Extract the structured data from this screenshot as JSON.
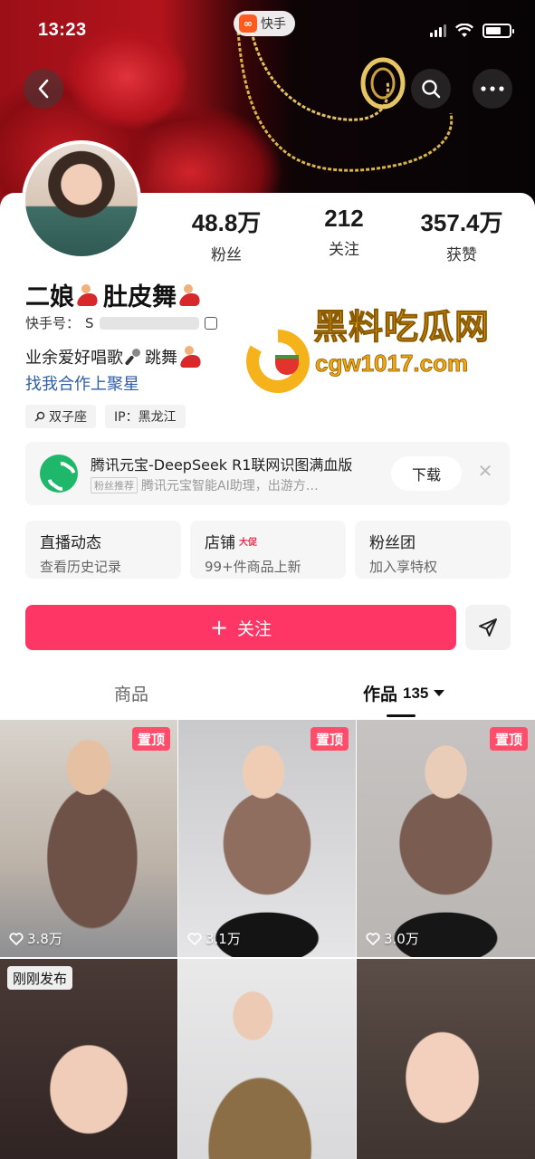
{
  "status_bar": {
    "time": "13:23",
    "app_name": "快手",
    "app_logo": "kuaishou-logo"
  },
  "nav": {
    "back_icon": "chevron-left-icon",
    "search_icon": "search-icon",
    "more_icon": "more-horizontal-icon"
  },
  "profile": {
    "stats": [
      {
        "value": "48.8万",
        "label": "粉丝"
      },
      {
        "value": "212",
        "label": "关注"
      },
      {
        "value": "357.4万",
        "label": "获赞"
      }
    ],
    "nickname_part1": "二娘",
    "nickname_part2": "肚皮舞",
    "kwai_id_label": "快手号：",
    "kwai_id_value": "S",
    "bio_part1": "业余爱好唱歌",
    "bio_part2": "跳舞",
    "cooperation_link": "找我合作上聚星",
    "tags": [
      {
        "icon": "zodiac-icon",
        "text": "双子座"
      },
      {
        "icon": "",
        "text": "IP：黑龙江"
      }
    ]
  },
  "watermark": {
    "title": "黑料吃瓜网",
    "url": "cgw1017.com"
  },
  "ad": {
    "title": "腾讯元宝-DeepSeek R1联网识图满血版",
    "badge": "粉丝推荐",
    "subtitle": "腾讯元宝智能AI助理，出游方…",
    "button": "下载",
    "close": "✕"
  },
  "features": [
    {
      "title": "直播动态",
      "sub": "查看历史记录",
      "badge": ""
    },
    {
      "title": "店铺",
      "sub": "99+件商品上新",
      "badge": "大促"
    },
    {
      "title": "粉丝团",
      "sub": "加入享特权",
      "badge": ""
    }
  ],
  "follow": {
    "plus": "+",
    "label": "关注"
  },
  "tabs": {
    "goods": "商品",
    "works": "作品",
    "works_count": "135"
  },
  "videos": [
    {
      "pinned": "置顶",
      "likes": "3.8万",
      "new_tag": ""
    },
    {
      "pinned": "置顶",
      "likes": "3.1万",
      "new_tag": ""
    },
    {
      "pinned": "置顶",
      "likes": "3.0万",
      "new_tag": ""
    },
    {
      "pinned": "",
      "likes": "",
      "new_tag": "刚刚发布"
    },
    {
      "pinned": "",
      "likes": "",
      "new_tag": ""
    },
    {
      "pinned": "",
      "likes": "",
      "new_tag": ""
    }
  ],
  "colors": {
    "accent": "#fe3666",
    "link": "#2f5da8",
    "pin": "#ff4d6b",
    "watermark": "#f3a712"
  }
}
